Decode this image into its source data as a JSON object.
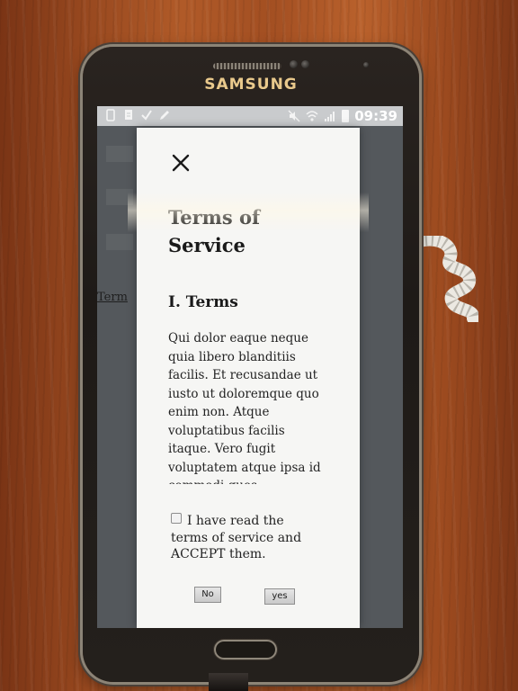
{
  "device": {
    "brand": "SAMSUNG"
  },
  "status_bar": {
    "time": "09:39",
    "left_icons": [
      "phone-icon",
      "document-icon",
      "checklist-icon",
      "pencil-icon"
    ],
    "right_icons": [
      "mute-icon",
      "wifi-icon",
      "signal-icon",
      "battery-icon"
    ]
  },
  "background_page": {
    "link_text": "Term"
  },
  "modal": {
    "close_icon": "close-icon",
    "title": "Terms of Service",
    "section_heading": "I. Terms",
    "body": "Qui dolor eaque neque quia libero blanditiis facilis. Et recusandae ut iusto ut doloremque quo enim non. Atque voluptatibus facilis itaque. Vero fugit voluptatem atque ipsa id commodi quos",
    "accept_label": "I have read the terms of service and ACCEPT them.",
    "accept_checked": false,
    "no_label": "No",
    "yes_label": "yes"
  },
  "colors": {
    "modal_background": "#f6f6f4",
    "status_bar": "#c9cbcd",
    "brand_text": "#e9c98c"
  }
}
